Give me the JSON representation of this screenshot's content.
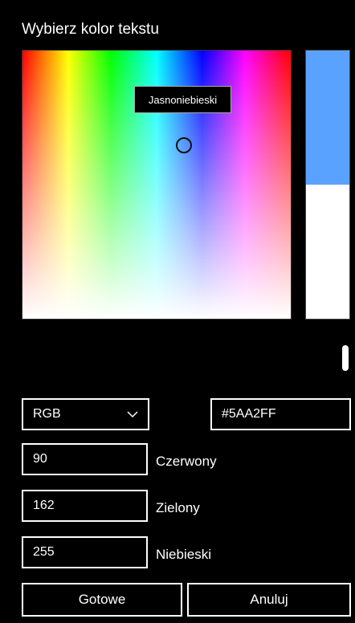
{
  "dialog": {
    "title": "Wybierz kolor tekstu"
  },
  "picker": {
    "tooltip": "Jasnoniebieski",
    "selected_color": "#5AA2FF",
    "value_level": 0.5
  },
  "mode": {
    "selected": "RGB"
  },
  "hex": {
    "value": "#5AA2FF"
  },
  "channels": {
    "red": {
      "value": "90",
      "label": "Czerwony"
    },
    "green": {
      "value": "162",
      "label": "Zielony"
    },
    "blue": {
      "value": "255",
      "label": "Niebieski"
    }
  },
  "buttons": {
    "done": "Gotowe",
    "cancel": "Anuluj"
  },
  "icons": {
    "dropdown": "chevron-down-icon"
  }
}
